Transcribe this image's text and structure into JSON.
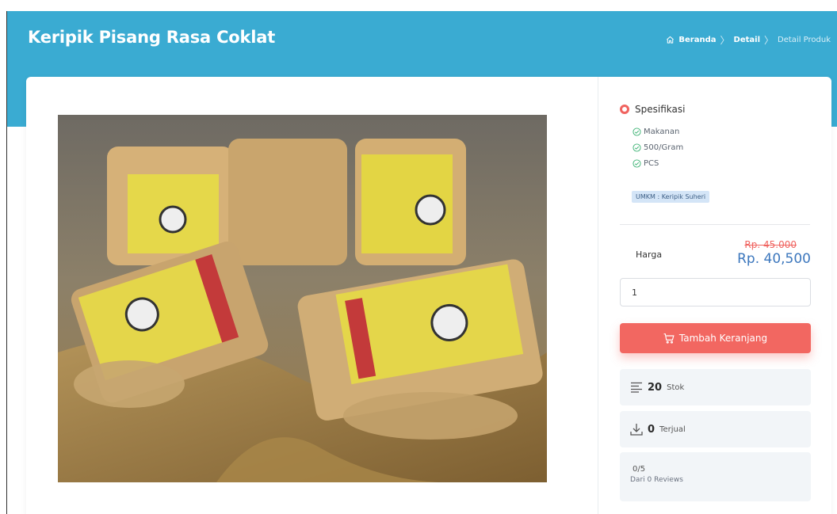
{
  "header": {
    "title": "Keripik Pisang Rasa Coklat",
    "breadcrumb": [
      "Beranda",
      "Detail",
      "Detail Produk"
    ]
  },
  "product": {
    "image_alt": "photo of banana chip packages"
  },
  "spec": {
    "heading": "Spesifikasi",
    "items": [
      "Makanan",
      "500/Gram",
      "PCS"
    ],
    "umkm": "UMKM : Keripik Suheri"
  },
  "price": {
    "label": "Harga",
    "old": "Rp. 45.000",
    "new": "Rp. 40,500"
  },
  "quantity": {
    "value": "1"
  },
  "cart_button": {
    "label": "Tambah Keranjang"
  },
  "stats": {
    "stock_value": "20",
    "stock_unit": "Stok",
    "sold_value": "0",
    "sold_unit": "Terjual"
  },
  "reviews": {
    "score": "0/5",
    "count": "Dari 0 Reviews"
  },
  "colors": {
    "header": "#3aabd2",
    "accent": "#f26761",
    "price_blue": "#3c77bd",
    "badge_bg": "#d4e5f7"
  },
  "icons": [
    "home-icon",
    "ring-icon",
    "check-circle-icon",
    "cart-icon",
    "list-icon",
    "download-icon"
  ]
}
